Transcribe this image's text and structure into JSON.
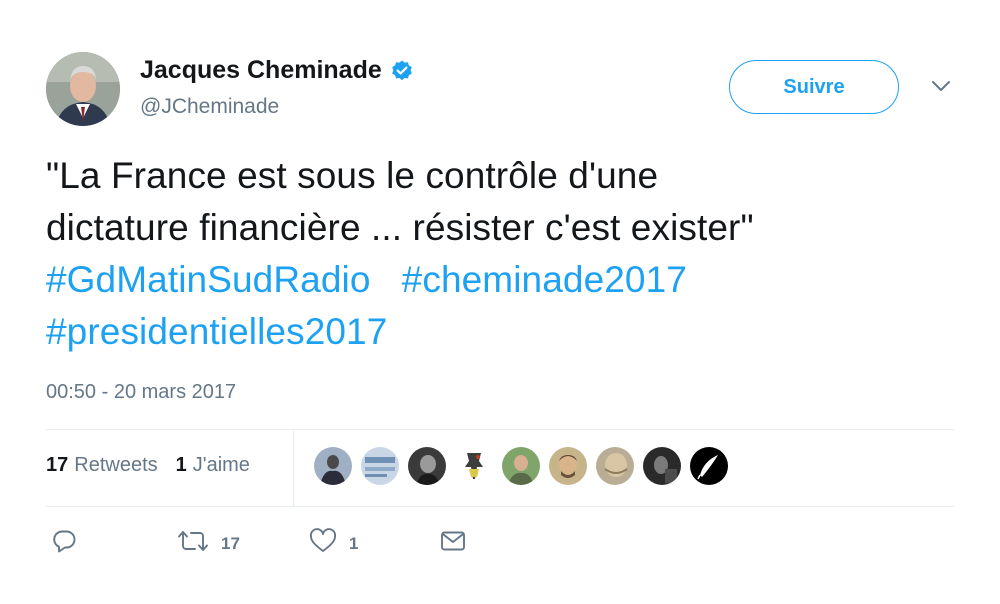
{
  "author": {
    "name": "Jacques Cheminade",
    "handle": "@JCheminade",
    "verified": true
  },
  "follow_button": {
    "label": "Suivre"
  },
  "tweet": {
    "text_line1": "\"La France est sous le contrôle d'une",
    "text_line2": "dictature financière ... résister c'est exister\"",
    "hashtags": [
      "#GdMatinSudRadio",
      "#cheminade2017",
      "#presidentielles2017"
    ]
  },
  "timestamp": "00:50 - 20 mars 2017",
  "stats": {
    "retweets_count": "17",
    "retweets_label": "Retweets",
    "likes_count": "1",
    "likes_label": "J'aime"
  },
  "actions": {
    "retweet_count": "17",
    "like_count": "1"
  },
  "colors": {
    "accent": "#1da1f2",
    "text": "#14171a",
    "secondary": "#657786",
    "divider": "#e6ecf0"
  },
  "icons": [
    "verified-badge-icon",
    "chevron-down-icon",
    "reply-icon",
    "retweet-icon",
    "like-icon",
    "direct-message-icon"
  ]
}
